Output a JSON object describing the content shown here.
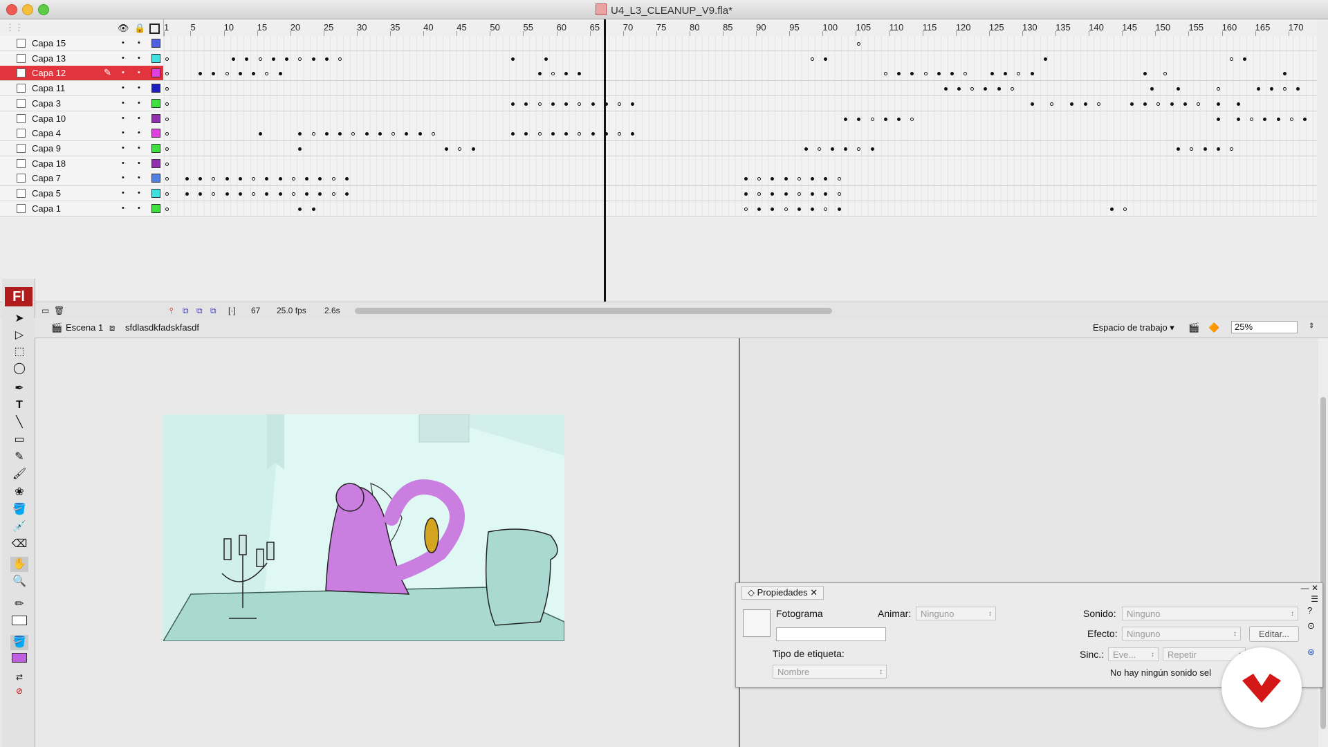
{
  "window": {
    "title": "U4_L3_CLEANUP_V9.fla*"
  },
  "timeline": {
    "ruler_ticks": [
      "1",
      "5",
      "10",
      "15",
      "20",
      "25",
      "30",
      "35",
      "40",
      "45",
      "50",
      "55",
      "60",
      "65",
      "70",
      "75",
      "80",
      "85",
      "90",
      "95",
      "100",
      "105",
      "110",
      "115",
      "120",
      "125",
      "130",
      "135",
      "140",
      "145",
      "150",
      "155",
      "160",
      "165",
      "170"
    ],
    "layers": [
      {
        "name": "Capa 15",
        "color": "#5060e0",
        "selected": false
      },
      {
        "name": "Capa 13",
        "color": "#40e0e0",
        "selected": false
      },
      {
        "name": "Capa 12",
        "color": "#e040e0",
        "selected": true
      },
      {
        "name": "Capa 11",
        "color": "#2020c0",
        "selected": false
      },
      {
        "name": "Capa 3",
        "color": "#40e040",
        "selected": false
      },
      {
        "name": "Capa 10",
        "color": "#9030b0",
        "selected": false
      },
      {
        "name": "Capa 4",
        "color": "#e040e0",
        "selected": false
      },
      {
        "name": "Capa 9",
        "color": "#40e040",
        "selected": false
      },
      {
        "name": "Capa 18",
        "color": "#9030b0",
        "selected": false
      },
      {
        "name": "Capa 7",
        "color": "#5080e0",
        "selected": false
      },
      {
        "name": "Capa 5",
        "color": "#40e0e0",
        "selected": false
      },
      {
        "name": "Capa 1",
        "color": "#40e040",
        "selected": false
      }
    ],
    "current_frame": "67",
    "fps": "25.0 fps",
    "elapsed": "2.6s"
  },
  "editbar": {
    "scene": "Escena 1",
    "symbol": "sfdlasdkfadskfasdf",
    "workspace": "Espacio de trabajo",
    "zoom": "25%"
  },
  "toolbar": {
    "app_label": "Fl"
  },
  "properties": {
    "tab": "Propiedades",
    "frame_label": "Fotograma",
    "frame_name_value": "",
    "animate_label": "Animar:",
    "animate_value": "Ninguno",
    "label_type_label": "Tipo de etiqueta:",
    "label_type_value": "Nombre",
    "sound_label": "Sonido:",
    "sound_value": "Ninguno",
    "effect_label": "Efecto:",
    "effect_value": "Ninguno",
    "edit_button": "Editar...",
    "sync_label": "Sinc.:",
    "sync_value": "Eve...",
    "repeat_value": "Repetir",
    "no_sound_text": "No hay ningún sonido sel"
  }
}
